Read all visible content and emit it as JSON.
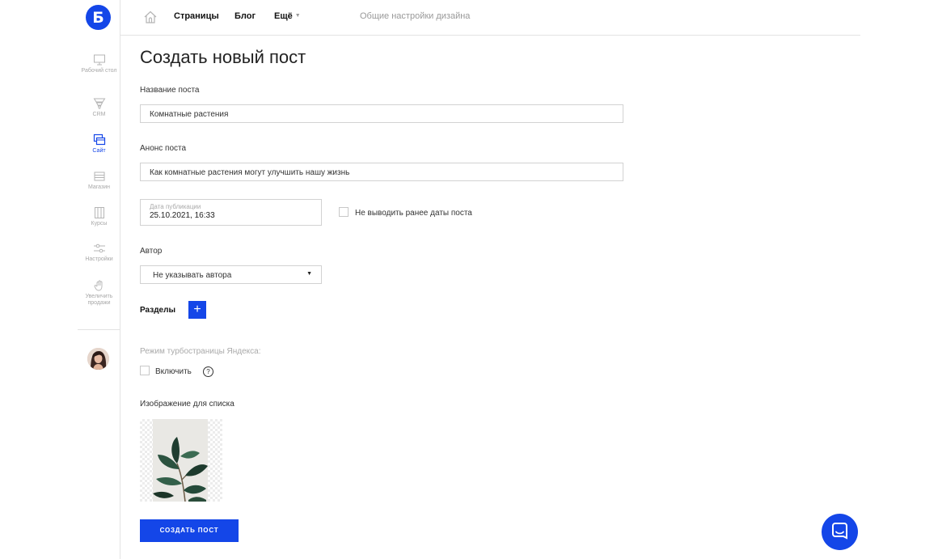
{
  "brand": {
    "logo_letter": "Б",
    "accent_color": "#1446e8"
  },
  "sidebar": {
    "items": [
      {
        "label": "Рабочий стол",
        "icon": "monitor-icon",
        "active": false
      },
      {
        "label": "CRM",
        "icon": "funnel-icon",
        "active": false
      },
      {
        "label": "Сайт",
        "icon": "site-pages-icon",
        "active": true
      },
      {
        "label": "Магазин",
        "icon": "shop-icon",
        "active": false
      },
      {
        "label": "Курсы",
        "icon": "courses-icon",
        "active": false
      },
      {
        "label": "Настройки",
        "icon": "sliders-icon",
        "active": false
      },
      {
        "label": "Увеличить продажи",
        "icon": "hand-icon",
        "active": false
      }
    ],
    "avatar": "user-avatar"
  },
  "topnav": {
    "home_icon": "home-icon",
    "links": [
      "Страницы",
      "Блог",
      "Ещё"
    ],
    "design_settings": "Общие настройки дизайна"
  },
  "page": {
    "title": "Создать новый пост",
    "post_name_label": "Название поста",
    "post_name_value": "Комнатные растения",
    "announce_label": "Анонс поста",
    "announce_value": "Как комнатные растения могут улучшить нашу жизнь",
    "date_label": "Дата публикации",
    "date_value": "25.10.2021, 16:33",
    "hide_before_date_label": "Не выводить ранее даты поста",
    "hide_before_date_checked": false,
    "author_label": "Автор",
    "author_value": "Не указывать автора",
    "sections_label": "Разделы",
    "add_section": "+",
    "turbo_label": "Режим турбостраницы Яндекса:",
    "turbo_enable_label": "Включить",
    "turbo_enable_checked": false,
    "help_glyph": "?",
    "image_label": "Изображение для списка",
    "create_button": "СОЗДАТЬ ПОСТ"
  },
  "chat": {
    "icon": "chat-icon"
  }
}
